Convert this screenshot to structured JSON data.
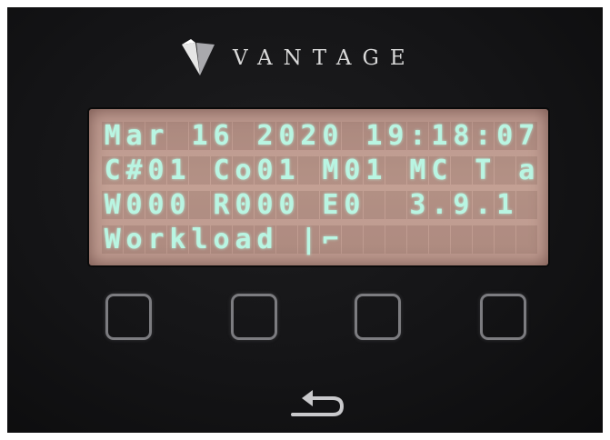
{
  "brand": {
    "name": "VANTAGE",
    "logo_icon": "vantage-v-logo-icon"
  },
  "display": {
    "rows": [
      "Mar 16 2020 19:18:07",
      "C#01 Co01 M01 MC T a",
      "W000 R000 E0  3.9.1 ",
      "Workload |⌐         "
    ],
    "text_color": "#b9f5e2",
    "backlight_color": "#c4a195"
  },
  "keypad": {
    "buttons": [
      {
        "icon": "square-button-icon"
      },
      {
        "icon": "square-button-icon"
      },
      {
        "icon": "square-button-icon"
      },
      {
        "icon": "square-button-icon"
      }
    ],
    "back_icon": "back-arrow-icon"
  }
}
